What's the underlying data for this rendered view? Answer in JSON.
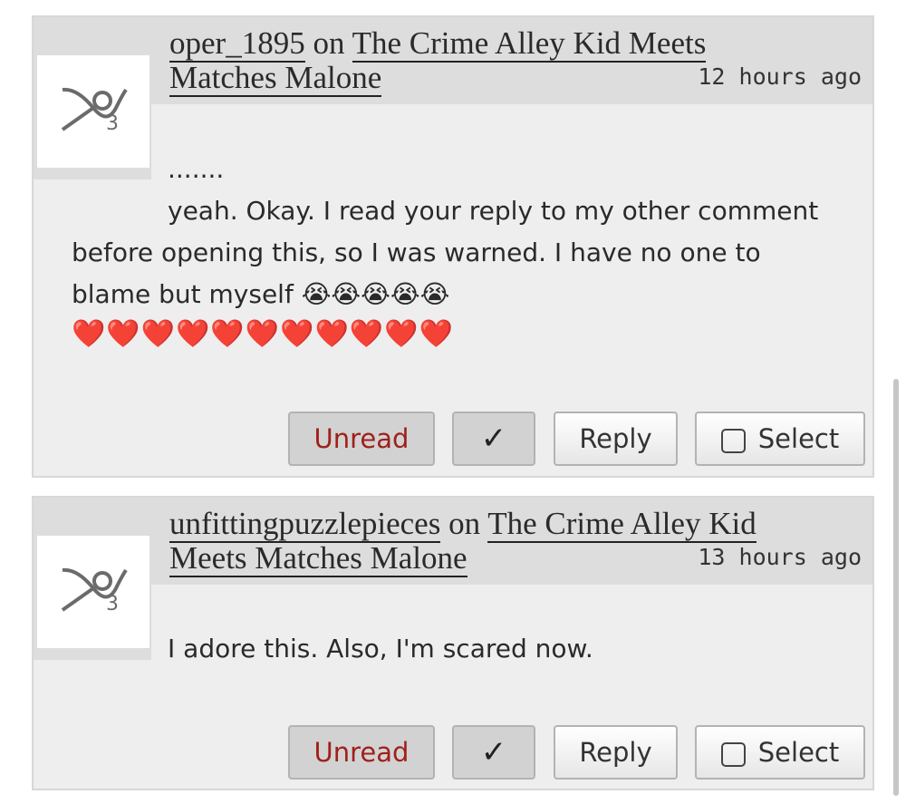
{
  "comments": [
    {
      "author": "oper_1895",
      "on_word": "on",
      "work_title": "The Crime Alley Kid Meets Matches Malone",
      "time": "12 hours ago",
      "lines": [
        ".......",
        "yeah. Okay. I read your reply to my other comment before opening this, so I was warned. I have no one to blame but myself 😭😭😭😭😭"
      ],
      "hearts": "❤️❤️❤️❤️❤️❤️❤️❤️❤️❤️❤️",
      "buttons": {
        "unread": "Unread",
        "check": "✓",
        "reply": "Reply",
        "select": "Select"
      }
    },
    {
      "author": "unfittingpuzzlepieces",
      "on_word": "on",
      "work_title": "The Crime Alley Kid Meets Matches Malone",
      "time": "13 hours ago",
      "lines": [
        "I adore this. Also, I'm scared now."
      ],
      "buttons": {
        "unread": "Unread",
        "check": "✓",
        "reply": "Reply",
        "select": "Select"
      }
    }
  ],
  "icons": {
    "avatar": "default-avatar-icon",
    "checkbox": "checkbox-icon",
    "checkmark": "checkmark-icon"
  },
  "colors": {
    "unread_text": "#a0201a",
    "heart": "#e0101e",
    "panel": "#eeeeee",
    "header": "#dddddd"
  }
}
